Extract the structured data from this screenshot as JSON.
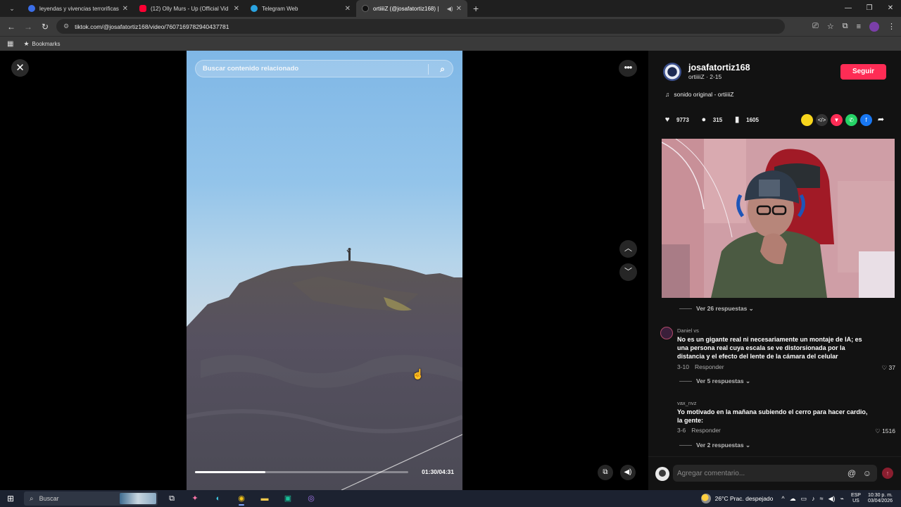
{
  "browser": {
    "tabs": [
      {
        "title": "leyendas y vivencias terrorificas",
        "favicon_color": "#3b6ee8",
        "favicon_glyph": "R",
        "active": false
      },
      {
        "title": "(12) Olly Murs - Up (Official Vid",
        "favicon_color": "#ff0033",
        "favicon_glyph": "▶",
        "active": false
      },
      {
        "title": "Telegram Web",
        "favicon_color": "#2aa3e0",
        "favicon_glyph": "➤",
        "active": false
      },
      {
        "title": "ortiiiiZ (@josafatortiz168) |",
        "favicon_color": "#111111",
        "favicon_glyph": "♪",
        "active": true
      }
    ],
    "url": "tiktok.com/@josafatortiz168/video/7607169782940437781",
    "bookmarks_label": "Bookmarks"
  },
  "video": {
    "search_placeholder": "Buscar contenido relacionado",
    "time": "01:30/04:31",
    "progress_fraction": 0.33
  },
  "author": {
    "username": "josafatortiz168",
    "subtitle": "ortiiiiZ · 2-15",
    "follow_label": "Seguir",
    "sound": "sonido original - ortiiiiZ"
  },
  "stats": {
    "likes": "9773",
    "comments": "315",
    "saves": "1605"
  },
  "share_colors": [
    "#f7d51c",
    "#333333",
    "#fe2c55",
    "#25d366",
    "#1877f2"
  ],
  "comments": {
    "toggle_1": "Ver 26 respuestas",
    "c1_user": "Daniel vs",
    "c1_text": "No es un gigante real ni necesariamente un montaje de IA; es una persona real cuya escala se ve distorsionada por la distancia y el efecto del lente de la cámara del celular",
    "c1_date": "3-10",
    "c1_reply": "Responder",
    "c1_likes": "37",
    "toggle_2": "Ver 5 respuestas",
    "c2_user": "vax_nvz",
    "c2_text": "Yo motivado en la mañana subiendo el cerro para hacer cardio, la gente:",
    "c2_date": "3-6",
    "c2_reply": "Responder",
    "c2_likes": "1516",
    "toggle_3": "Ver 2 respuestas"
  },
  "comment_input_placeholder": "Agregar comentario...",
  "taskbar": {
    "search_label": "Buscar",
    "weather": "26°C  Prac. despejado",
    "lang_1": "ESP",
    "lang_2": "US",
    "time": "10:30 p. m.",
    "date": "03/04/2026"
  }
}
